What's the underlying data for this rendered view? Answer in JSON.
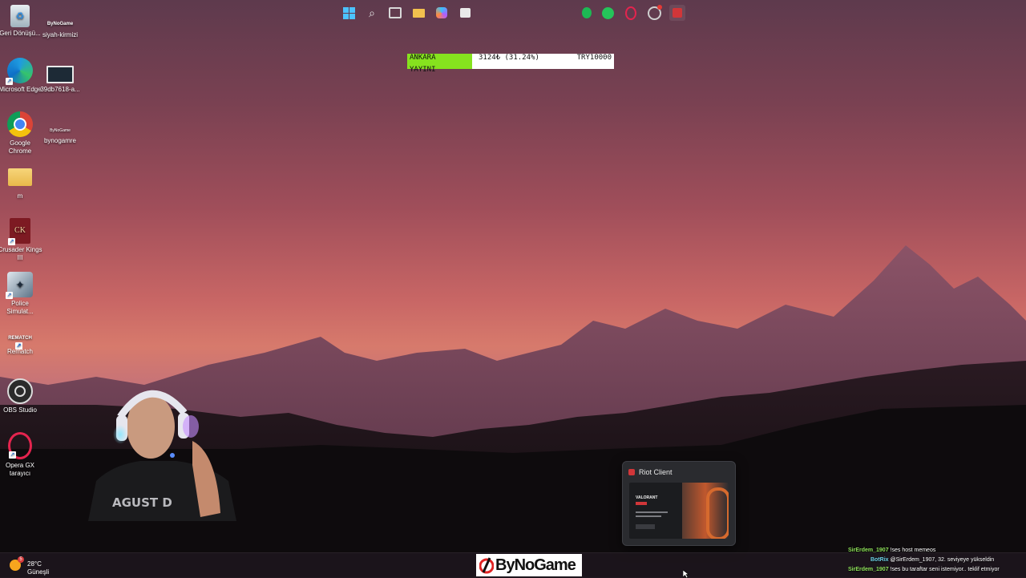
{
  "desktop_icons": [
    {
      "label": "Geri Dönüşü...",
      "icon": "recycle-bin-icon"
    },
    {
      "label": "siyah-kirmizi",
      "icon": "bynogame-file-icon",
      "overlay": "ByNoGame"
    },
    {
      "label": "Microsoft Edge",
      "icon": "edge-icon"
    },
    {
      "label": "39db7618-a...",
      "icon": "image-file-icon"
    },
    {
      "label": "Google Chrome",
      "icon": "chrome-icon"
    },
    {
      "label": "bynogamre",
      "icon": "bynogame-file-icon",
      "overlay": "ByNoGame"
    },
    {
      "label": "m",
      "icon": "folder-icon"
    },
    {
      "label": "Crusader Kings III",
      "icon": "crusader-kings-icon",
      "overlay": "CK"
    },
    {
      "label": "Police Simulat...",
      "icon": "police-simulator-icon"
    },
    {
      "label": "Rematch",
      "icon": "rematch-icon",
      "overlay": "REMATCH"
    },
    {
      "label": "OBS Studio",
      "icon": "obs-icon"
    },
    {
      "label": "Opera GX tarayıcı",
      "icon": "opera-gx-icon"
    }
  ],
  "donation": {
    "title_line1": "ANKARA",
    "title_line2": "YAYINI",
    "amount": "3124₺ (31.24%)",
    "goal": "TRY10000",
    "progress": 0.3124,
    "fill_color": "#86e21e"
  },
  "riot_preview": {
    "title": "Riot Client",
    "thumb_title": "VALORANT",
    "accent": "#d13639"
  },
  "taskbar": {
    "weather_temp": "28°C",
    "weather_desc": "Güneşli",
    "weather_badge": "5",
    "logo_text": "ByNoGame",
    "apps": [
      "start-icon",
      "search-icon",
      "task-view-icon",
      "file-explorer-icon",
      "copilot-icon",
      "store-icon",
      "spotify-icon",
      "chat-app-icon",
      "opera-gx-icon",
      "steam-icon",
      "riot-client-icon"
    ]
  },
  "chat": [
    {
      "user": "SirErdem_1907",
      "text": "!ses host memeos",
      "bot": false
    },
    {
      "user": "BotRix",
      "text": "@SirErdem_1907, 32. seviyeye yükseldin",
      "bot": true
    },
    {
      "user": "SirErdem_1907",
      "text": "!ses bu taraftar seni istemiyor.. teklif etmiyor",
      "bot": false
    }
  ],
  "webcam_shirt_text": "AGUST D"
}
